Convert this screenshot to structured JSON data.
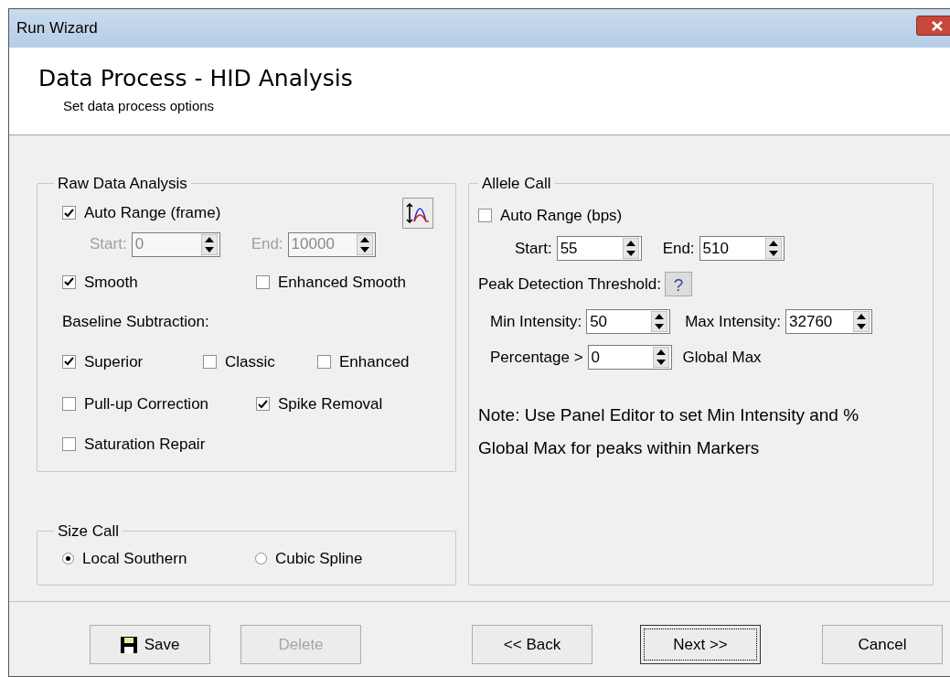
{
  "window": {
    "title": "Run Wizard"
  },
  "header": {
    "title": "Data Process - HID Analysis",
    "subtitle": "Set data process options"
  },
  "raw_data_analysis": {
    "title": "Raw Data Analysis",
    "auto_range": {
      "label": "Auto Range (frame)",
      "checked": true
    },
    "start": {
      "label": "Start:",
      "value": "0",
      "disabled": true
    },
    "end": {
      "label": "End:",
      "value": "10000",
      "disabled": true
    },
    "smooth_row": [
      {
        "label": "Smooth",
        "checked": true
      },
      {
        "label": "Enhanced Smooth",
        "checked": false
      }
    ],
    "baseline_label": "Baseline Subtraction:",
    "baseline_row": [
      {
        "label": "Superior",
        "checked": true
      },
      {
        "label": "Classic",
        "checked": false
      },
      {
        "label": "Enhanced",
        "checked": false
      }
    ],
    "correction_row": [
      {
        "label": "Pull-up Correction",
        "checked": false
      },
      {
        "label": "Spike Removal",
        "checked": true
      }
    ],
    "saturation": {
      "label": "Saturation Repair",
      "checked": false
    }
  },
  "size_call": {
    "title": "Size Call",
    "options": [
      {
        "label": "Local Southern",
        "selected": true
      },
      {
        "label": "Cubic Spline",
        "selected": false
      }
    ]
  },
  "allele_call": {
    "title": "Allele Call",
    "auto_range": {
      "label": "Auto Range (bps)",
      "checked": false
    },
    "start": {
      "label": "Start:",
      "value": "55",
      "disabled": false
    },
    "end": {
      "label": "End:",
      "value": "510",
      "disabled": false
    },
    "threshold_label": "Peak Detection Threshold:",
    "help_button": "?",
    "min_intensity": {
      "label": "Min Intensity:",
      "value": "50",
      "disabled": false
    },
    "max_intensity": {
      "label": "Max Intensity:",
      "value": "32760",
      "disabled": false
    },
    "percentage": {
      "label": "Percentage >",
      "value": "0",
      "disabled": false
    },
    "global_max": "Global Max",
    "note": "Note: Use Panel Editor to set Min Intensity and % Global Max for peaks within Markers"
  },
  "buttons": [
    {
      "kind": "save",
      "label": "Save",
      "disabled": false,
      "default": false
    },
    {
      "kind": "plain",
      "label": "Delete",
      "disabled": true,
      "default": false
    },
    {
      "kind": "plain",
      "label": "<< Back",
      "disabled": false,
      "default": false
    },
    {
      "kind": "plain",
      "label": "Next >>",
      "disabled": false,
      "default": true
    },
    {
      "kind": "plain",
      "label": "Cancel",
      "disabled": false,
      "default": false
    }
  ]
}
